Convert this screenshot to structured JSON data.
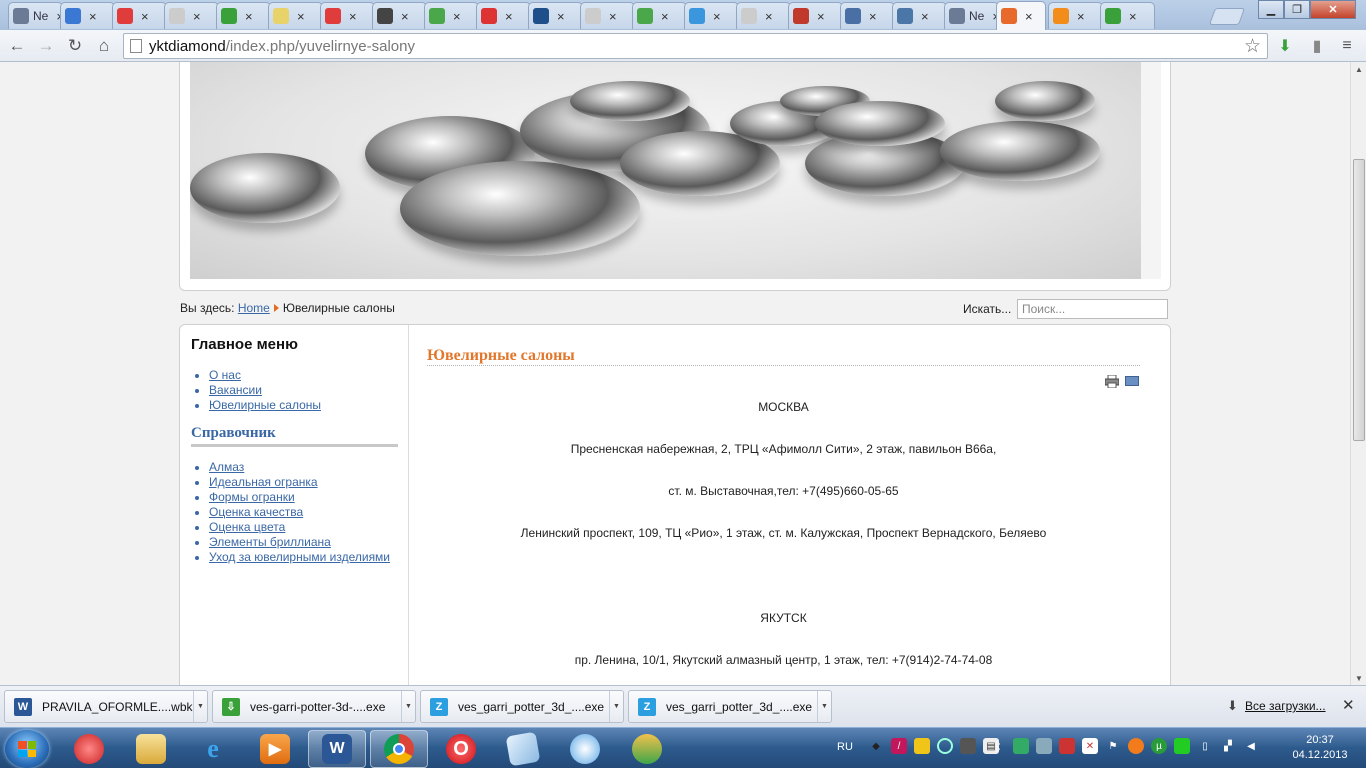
{
  "browser": {
    "tabs": [
      {
        "label": "Ne",
        "icon": "ne-icon",
        "color": "#6c7b95"
      },
      {
        "label": "",
        "icon": "p-icon",
        "color": "#3a78d4"
      },
      {
        "label": "",
        "icon": "target-icon",
        "color": "#e03c3c"
      },
      {
        "label": "",
        "icon": "page-icon",
        "color": "#cccccc"
      },
      {
        "label": "",
        "icon": "windows-icon",
        "color": "#3aa13a"
      },
      {
        "label": "",
        "icon": "note-icon",
        "color": "#e8d36a"
      },
      {
        "label": "",
        "icon": "yandex-icon",
        "color": "#e03c3c"
      },
      {
        "label": "",
        "icon": "grad-cap-icon",
        "color": "#444444"
      },
      {
        "label": "",
        "icon": "check-icon",
        "color": "#4aa84a"
      },
      {
        "label": "",
        "icon": "x-icon",
        "color": "#d33"
      },
      {
        "label": "",
        "icon": "r-icon",
        "color": "#1f4f8a"
      },
      {
        "label": "",
        "icon": "page-icon",
        "color": "#cccccc"
      },
      {
        "label": "",
        "icon": "check-icon",
        "color": "#4aa84a"
      },
      {
        "label": "",
        "icon": "v-icon",
        "color": "#3a96dd"
      },
      {
        "label": "",
        "icon": "page-icon",
        "color": "#cccccc"
      },
      {
        "label": "",
        "icon": "grid-icon",
        "color": "#c0392b"
      },
      {
        "label": "",
        "icon": "play-icon",
        "color": "#4a6fa5"
      },
      {
        "label": "",
        "icon": "vk-icon",
        "color": "#4a76a8"
      },
      {
        "label": "Ne",
        "icon": "ne-icon",
        "color": "#6c7b95"
      },
      {
        "label": "",
        "icon": "joomla-active-icon",
        "color": "#e7692b"
      },
      {
        "label": "",
        "icon": "joomla-icon",
        "color": "#f28c1b"
      },
      {
        "label": "",
        "icon": "download-icon",
        "color": "#3aa13a"
      }
    ],
    "url_host": "yktdiamond",
    "url_path": "/index.php/yuvelirnye-salony"
  },
  "breadcrumb": {
    "prefix": "Вы здесь:",
    "home": "Home",
    "current": "Ювелирные салоны"
  },
  "search": {
    "label": "Искать...",
    "placeholder": "Поиск..."
  },
  "sidebar": {
    "menu_title": "Главное меню",
    "menu_items": [
      "О нас",
      "Вакансии",
      "Ювелирные салоны"
    ],
    "ref_title": "Справочник",
    "ref_items": [
      "Алмаз",
      "Идеальная огранка",
      "Формы огранки",
      "Оценка качества",
      "Оценка цвета",
      "Элементы бриллиана",
      "Уход за ювелирными изделиями"
    ]
  },
  "article": {
    "title": "Ювелирные салоны",
    "paragraphs": [
      "МОСКВА",
      "Пресненская набережная, 2, ТРЦ  «Афимолл Сити», 2 этаж, павильон B66a,",
      "ст. м. Выставочная,тел: +7(495)660-05-65",
      "Ленинский проспект, 109, ТЦ «Рио», 1 этаж, ст. м. Калужская, Проспект Вернадского, Беляево",
      "ЯКУТСК",
      "пр. Ленина, 10/1, Якутский алмазный центр, 1 этаж, тел: +7(914)2-74-74-08"
    ]
  },
  "downloads": {
    "items": [
      {
        "name": "PRAVILA_OFORMLE....wbk",
        "icon": "word-icon",
        "color": "#2b5797",
        "glyph": "W"
      },
      {
        "name": "ves-garri-potter-3d-....exe",
        "icon": "download-arrow-icon",
        "color": "#3aa13a",
        "glyph": "⇩"
      },
      {
        "name": "ves_garri_potter_3d_....exe",
        "icon": "installer-icon",
        "color": "#2c9fe0",
        "glyph": "Z"
      },
      {
        "name": "ves_garri_potter_3d_....exe",
        "icon": "installer-icon",
        "color": "#2c9fe0",
        "glyph": "Z"
      }
    ],
    "all_label": "Все загрузки..."
  },
  "taskbar": {
    "lang": "RU",
    "time": "20:37",
    "date": "04.12.2013"
  }
}
